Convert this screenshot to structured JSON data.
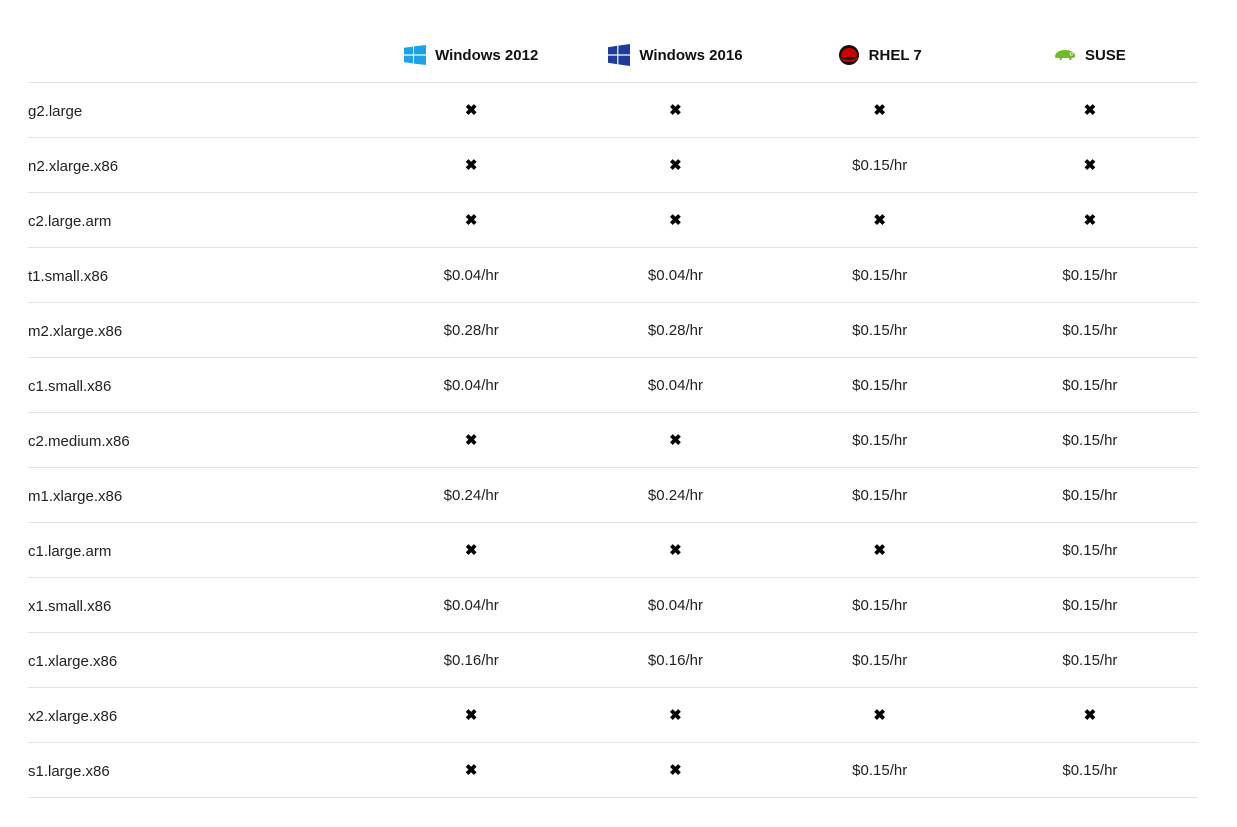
{
  "columns": [
    {
      "label": "Windows 2012",
      "icon": "windows-icon",
      "color": "#1aa3e8"
    },
    {
      "label": "Windows 2016",
      "icon": "windows-icon",
      "color": "#1d3c9e"
    },
    {
      "label": "RHEL 7",
      "icon": "redhat-icon",
      "color": "#cc0000"
    },
    {
      "label": "SUSE",
      "icon": "suse-chameleon-icon",
      "color": "#73ba25"
    }
  ],
  "unavailable_symbol": "✖",
  "rows": [
    {
      "name": "g2.large",
      "prices": [
        "✖",
        "✖",
        "✖",
        "✖"
      ]
    },
    {
      "name": "n2.xlarge.x86",
      "prices": [
        "✖",
        "✖",
        "$0.15/hr",
        "✖"
      ]
    },
    {
      "name": "c2.large.arm",
      "prices": [
        "✖",
        "✖",
        "✖",
        "✖"
      ]
    },
    {
      "name": "t1.small.x86",
      "prices": [
        "$0.04/hr",
        "$0.04/hr",
        "$0.15/hr",
        "$0.15/hr"
      ]
    },
    {
      "name": "m2.xlarge.x86",
      "prices": [
        "$0.28/hr",
        "$0.28/hr",
        "$0.15/hr",
        "$0.15/hr"
      ]
    },
    {
      "name": "c1.small.x86",
      "prices": [
        "$0.04/hr",
        "$0.04/hr",
        "$0.15/hr",
        "$0.15/hr"
      ]
    },
    {
      "name": "c2.medium.x86",
      "prices": [
        "✖",
        "✖",
        "$0.15/hr",
        "$0.15/hr"
      ]
    },
    {
      "name": "m1.xlarge.x86",
      "prices": [
        "$0.24/hr",
        "$0.24/hr",
        "$0.15/hr",
        "$0.15/hr"
      ]
    },
    {
      "name": "c1.large.arm",
      "prices": [
        "✖",
        "✖",
        "✖",
        "$0.15/hr"
      ]
    },
    {
      "name": "x1.small.x86",
      "prices": [
        "$0.04/hr",
        "$0.04/hr",
        "$0.15/hr",
        "$0.15/hr"
      ]
    },
    {
      "name": "c1.xlarge.x86",
      "prices": [
        "$0.16/hr",
        "$0.16/hr",
        "$0.15/hr",
        "$0.15/hr"
      ]
    },
    {
      "name": "x2.xlarge.x86",
      "prices": [
        "✖",
        "✖",
        "✖",
        "✖"
      ]
    },
    {
      "name": "s1.large.x86",
      "prices": [
        "✖",
        "✖",
        "$0.15/hr",
        "$0.15/hr"
      ]
    }
  ]
}
